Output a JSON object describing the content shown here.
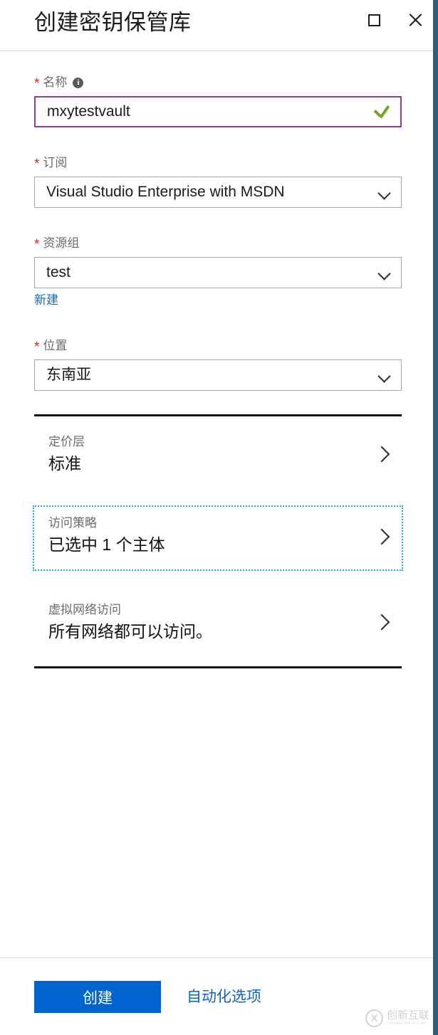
{
  "header": {
    "title": "创建密钥保管库",
    "maximize_icon": "maximize-icon",
    "close_icon": "close-icon"
  },
  "form": {
    "name": {
      "label": "名称",
      "required_marker": "*",
      "info_icon": "i",
      "value": "mxytestvault",
      "validation_icon": "checkmark-icon",
      "border_color": "#8e3f90",
      "valid_color": "#6fa723"
    },
    "subscription": {
      "label": "订阅",
      "required_marker": "*",
      "value": "Visual Studio Enterprise with MSDN"
    },
    "resource_group": {
      "label": "资源组",
      "required_marker": "*",
      "value": "test",
      "create_new_link": "新建"
    },
    "location": {
      "label": "位置",
      "required_marker": "*",
      "value": "东南亚"
    }
  },
  "detail_rows": [
    {
      "label": "定价层",
      "value": "标准",
      "focused": false
    },
    {
      "label": "访问策略",
      "value": "已选中 1 个主体",
      "focused": true,
      "focus_color": "#27a9d4"
    },
    {
      "label": "虚拟网络访问",
      "value": "所有网络都可以访问。",
      "focused": false
    }
  ],
  "footer": {
    "create_label": "创建",
    "create_color": "#0063ce",
    "automation_label": "自动化选项",
    "link_color": "#0a66c2"
  },
  "watermark": {
    "mark": "X",
    "text": "创新互联",
    "subtext": "CHUANGXIN HULIAN"
  }
}
